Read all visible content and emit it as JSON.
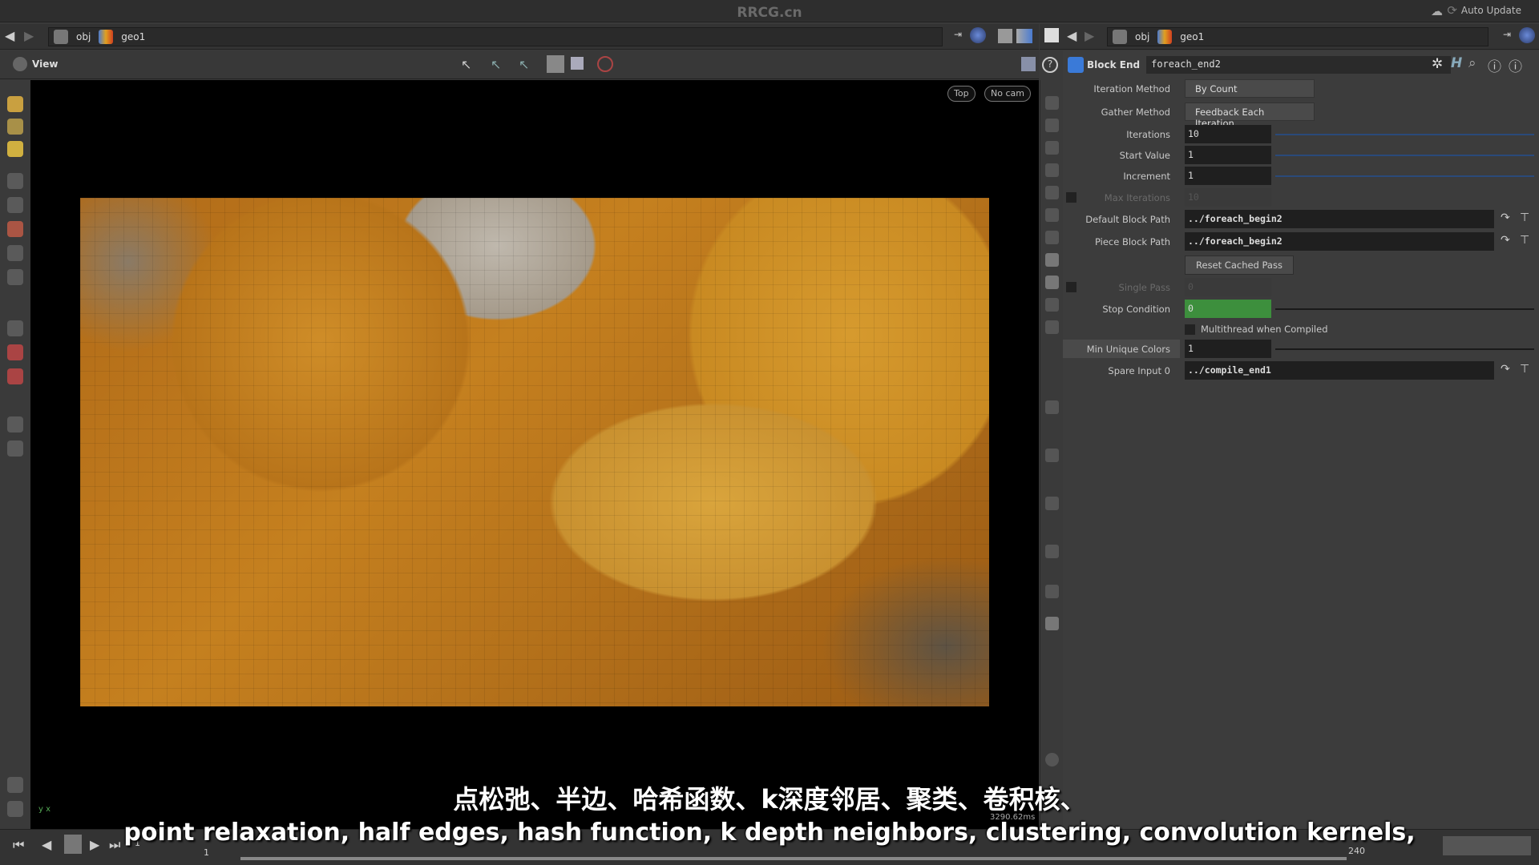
{
  "window": {
    "title": "RRCG.cn",
    "auto_update": "Auto Update"
  },
  "left_path": {
    "items": [
      "obj",
      "geo1"
    ]
  },
  "right_path": {
    "items": [
      "obj",
      "geo1"
    ]
  },
  "viewport": {
    "label": "View",
    "camera_view": "Top",
    "camera": "No cam",
    "stats": "3290.62ms",
    "axis": "y x"
  },
  "node": {
    "type": "Block End",
    "name": "foreach_end2"
  },
  "params": {
    "iteration_method": {
      "label": "Iteration Method",
      "value": "By Count"
    },
    "gather_method": {
      "label": "Gather Method",
      "value": "Feedback Each Iteration"
    },
    "iterations": {
      "label": "Iterations",
      "value": "10"
    },
    "start_value": {
      "label": "Start Value",
      "value": "1"
    },
    "increment": {
      "label": "Increment",
      "value": "1"
    },
    "max_iterations": {
      "label": "Max Iterations",
      "value": "10",
      "enabled": false
    },
    "default_block_path": {
      "label": "Default Block Path",
      "value": "../foreach_begin2"
    },
    "piece_block_path": {
      "label": "Piece Block Path",
      "value": "../foreach_begin2"
    },
    "reset_cached_pass": {
      "label": "Reset Cached Pass"
    },
    "single_pass": {
      "label": "Single Pass",
      "value": "0",
      "enabled": false
    },
    "stop_condition": {
      "label": "Stop Condition",
      "value": "0"
    },
    "multithread": {
      "label": "Multithread when Compiled",
      "checked": false
    },
    "min_unique_colors": {
      "label": "Min Unique Colors",
      "value": "1"
    },
    "spare_input0": {
      "label": "Spare Input 0",
      "value": "../compile_end1"
    }
  },
  "timeline": {
    "current_frame": "1",
    "start_frame": "1",
    "end_frame": "240"
  },
  "subtitles": {
    "zh": "点松弛、半边、哈希函数、k深度邻居、聚类、卷积核、",
    "en": "point relaxation, half edges, hash function, k depth neighbors, clustering, convolution kernels,"
  },
  "colors": {
    "stop_condition_bg": "#3d8f3d",
    "slider": "#2a4a7a"
  }
}
